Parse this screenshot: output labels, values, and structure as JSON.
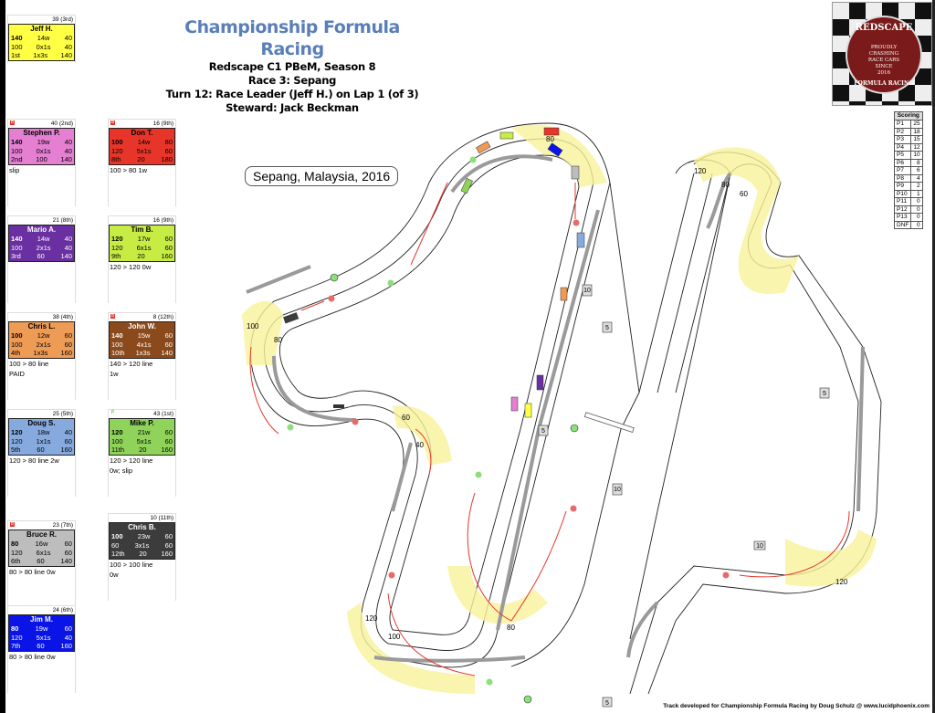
{
  "header": {
    "title": "Championship Formula Racing",
    "league": "Redscape C1 PBeM, Season 8",
    "race": "Race 3: Sepang",
    "turn": "Turn 12: Race Leader (Jeff H.) on Lap 1 (of 3)",
    "steward": "Steward: Jack Beckman"
  },
  "location_label": "Sepang, Malaysia, 2016",
  "logo": {
    "top_text": "REDSCAPE",
    "middle_text": [
      "PROUDLY",
      "CRASHING",
      "RACE CARS",
      "SINCE",
      "2016"
    ],
    "bottom_text": "FORMULA RACING"
  },
  "drivers": [
    {
      "name": "Jeff H.",
      "points": "39 (3rd)",
      "flag": "",
      "color": "#ffff44",
      "text_color": "#000000",
      "row1": [
        "140",
        "14w",
        "40"
      ],
      "row2": [
        "100",
        "0x1s",
        "40"
      ],
      "row3": [
        "1st",
        "1x3s",
        "140"
      ],
      "notes": [
        "",
        ""
      ]
    },
    {
      "name": "Stephen P.",
      "points": "40 (2nd)",
      "flag": "B",
      "color": "#e47fd2",
      "text_color": "#000000",
      "row1": [
        "140",
        "19w",
        "40"
      ],
      "row2": [
        "100",
        "0x1s",
        "40"
      ],
      "row3": [
        "2nd",
        "100",
        "140"
      ],
      "notes": [
        "slip",
        ""
      ]
    },
    {
      "name": "Don T.",
      "points": "16 (9th)",
      "flag": "B",
      "color": "#e8352a",
      "text_color": "#000000",
      "row1": [
        "100",
        "14w",
        "80"
      ],
      "row2": [
        "120",
        "5x1s",
        "60"
      ],
      "row3": [
        "8th",
        "20",
        "180"
      ],
      "notes": [
        "100 > 80 1w",
        ""
      ]
    },
    {
      "name": "Mario A.",
      "points": "21 (8th)",
      "flag": "",
      "color": "#6a2fa0",
      "text_color": "#ffffff",
      "row1": [
        "140",
        "14w",
        "40"
      ],
      "row2": [
        "100",
        "2x1s",
        "40"
      ],
      "row3": [
        "3rd",
        "60",
        "140"
      ],
      "notes": [
        "",
        ""
      ]
    },
    {
      "name": "Tim B.",
      "points": "16 (9th)",
      "flag": "",
      "color": "#c7ec44",
      "text_color": "#000000",
      "row1": [
        "120",
        "17w",
        "60"
      ],
      "row2": [
        "120",
        "6x1s",
        "60"
      ],
      "row3": [
        "9th",
        "20",
        "160"
      ],
      "notes": [
        "120 > 120 0w",
        ""
      ]
    },
    {
      "name": "Chris L.",
      "points": "38 (4th)",
      "flag": "",
      "color": "#ee9b55",
      "text_color": "#000000",
      "row1": [
        "100",
        "12w",
        "60"
      ],
      "row2": [
        "100",
        "2x1s",
        "60"
      ],
      "row3": [
        "4th",
        "1x3s",
        "160"
      ],
      "notes": [
        "100 > 80 line",
        "PAID"
      ]
    },
    {
      "name": "John W.",
      "points": "8 (12th)",
      "flag": "B",
      "color": "#8b4a1c",
      "text_color": "#ffffff",
      "row1": [
        "140",
        "15w",
        "60"
      ],
      "row2": [
        "100",
        "4x1s",
        "60"
      ],
      "row3": [
        "10th",
        "1x3s",
        "140"
      ],
      "notes": [
        "140 > 120 line",
        "1w"
      ]
    },
    {
      "name": "Doug S.",
      "points": "25 (5th)",
      "flag": "",
      "color": "#86aadd",
      "text_color": "#000000",
      "row1": [
        "120",
        "18w",
        "40"
      ],
      "row2": [
        "120",
        "1x1s",
        "60"
      ],
      "row3": [
        "5th",
        "60",
        "160"
      ],
      "notes": [
        "120 > 80 line 2w",
        ""
      ]
    },
    {
      "name": "Mike P.",
      "points": "43 (1st)",
      "flag": "P",
      "color": "#8fd35a",
      "text_color": "#000000",
      "row1": [
        "120",
        "21w",
        "60"
      ],
      "row2": [
        "100",
        "5x1s",
        "60"
      ],
      "row3": [
        "11th",
        "20",
        "160"
      ],
      "notes": [
        "120 > 120 line",
        "0w; slip"
      ]
    },
    {
      "name": "Bruce R.",
      "points": "23 (7th)",
      "flag": "B",
      "color": "#bdbdbd",
      "text_color": "#000000",
      "row1": [
        "80",
        "16w",
        "60"
      ],
      "row2": [
        "120",
        "6x1s",
        "60"
      ],
      "row3": [
        "6th",
        "60",
        "140"
      ],
      "notes": [
        "80 > 80 line 0w",
        ""
      ]
    },
    {
      "name": "Chris B.",
      "points": "10 (11th)",
      "flag": "",
      "color": "#3c3c3c",
      "text_color": "#ffffff",
      "row1": [
        "100",
        "23w",
        "60"
      ],
      "row2": [
        "60",
        "3x1s",
        "60"
      ],
      "row3": [
        "12th",
        "20",
        "160"
      ],
      "notes": [
        "100 > 100 line",
        "0w"
      ]
    },
    {
      "name": "Jim M.",
      "points": "24 (6th)",
      "flag": "",
      "color": "#0a14e6",
      "text_color": "#ffffff",
      "row1": [
        "80",
        "19w",
        "60"
      ],
      "row2": [
        "120",
        "5x1s",
        "40"
      ],
      "row3": [
        "7th",
        "60",
        "160"
      ],
      "notes": [
        "80 > 80 line 0w",
        ""
      ]
    }
  ],
  "scoring": {
    "header": "Scoring",
    "rows": [
      [
        "P1",
        "25"
      ],
      [
        "P2",
        "18"
      ],
      [
        "P3",
        "15"
      ],
      [
        "P4",
        "12"
      ],
      [
        "P5",
        "10"
      ],
      [
        "P6",
        "8"
      ],
      [
        "P7",
        "6"
      ],
      [
        "P8",
        "4"
      ],
      [
        "P9",
        "2"
      ],
      [
        "P10",
        "1"
      ],
      [
        "P11",
        "0"
      ],
      [
        "P12",
        "0"
      ],
      [
        "P13",
        "0"
      ],
      [
        "DNF",
        "0"
      ]
    ]
  },
  "track": {
    "corner_speed_labels": [
      "120",
      "100",
      "80",
      "60",
      "40"
    ],
    "distance_markers": [
      "10",
      "5",
      "10",
      "5",
      "5",
      "10",
      "5"
    ],
    "colors": {
      "track_line": "#222222",
      "corner_fill": "#f8f29a",
      "wall": "#9a9a9a",
      "move_arrow": "#e8352a",
      "marker_red": "#e86a6a",
      "marker_green": "#8be07a"
    }
  },
  "footer": "Track developed for Championship Formula Racing by Doug Schulz @ www.lucidphoenix.com"
}
